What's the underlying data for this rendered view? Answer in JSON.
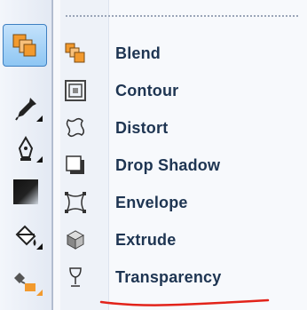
{
  "toolbox": {
    "tools": [
      {
        "name": "effects-tool",
        "icon": "blend-effects-icon",
        "active": true
      },
      {
        "name": "eyedropper-tool",
        "icon": "eyedropper-icon"
      },
      {
        "name": "outline-pen-tool",
        "icon": "pen-nib-icon"
      },
      {
        "name": "fill-tool",
        "icon": "fill-swatch-icon"
      },
      {
        "name": "paint-bucket-tool",
        "icon": "paint-bucket-icon"
      },
      {
        "name": "interactive-fill-tool",
        "icon": "interactive-fill-icon"
      }
    ]
  },
  "menu": {
    "items": [
      {
        "label": "Blend",
        "icon": "blend-icon"
      },
      {
        "label": "Contour",
        "icon": "contour-icon"
      },
      {
        "label": "Distort",
        "icon": "distort-icon"
      },
      {
        "label": "Drop Shadow",
        "icon": "drop-shadow-icon"
      },
      {
        "label": "Envelope",
        "icon": "envelope-icon"
      },
      {
        "label": "Extrude",
        "icon": "extrude-icon"
      },
      {
        "label": "Transparency",
        "icon": "wine-glass-icon"
      }
    ]
  },
  "annotation": {
    "color": "#e2231a",
    "target": "Transparency"
  },
  "colors": {
    "accent": "#8ec6f3",
    "label": "#1e3552",
    "orange": "#f29a2e"
  }
}
